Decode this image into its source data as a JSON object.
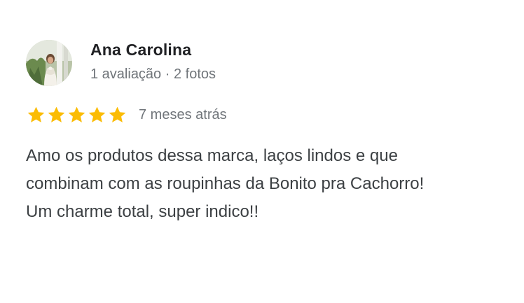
{
  "reviewer": {
    "name": "Ana Carolina",
    "meta": "1 avaliação · 2 fotos",
    "avatar_icon": "profile-photo-avatar"
  },
  "rating": {
    "stars": 5,
    "max_stars": 5,
    "star_color": "#fbbc04",
    "date": "7 meses atrás"
  },
  "review": {
    "lines": [
      "Amo os produtos dessa marca, laços lindos e que",
      "combinam com as roupinhas da Bonito pra Cachorro!",
      "Um charme total, super indico!!"
    ]
  },
  "colors": {
    "name": "#202124",
    "secondary": "#70757a",
    "body_text": "#3c4043"
  }
}
